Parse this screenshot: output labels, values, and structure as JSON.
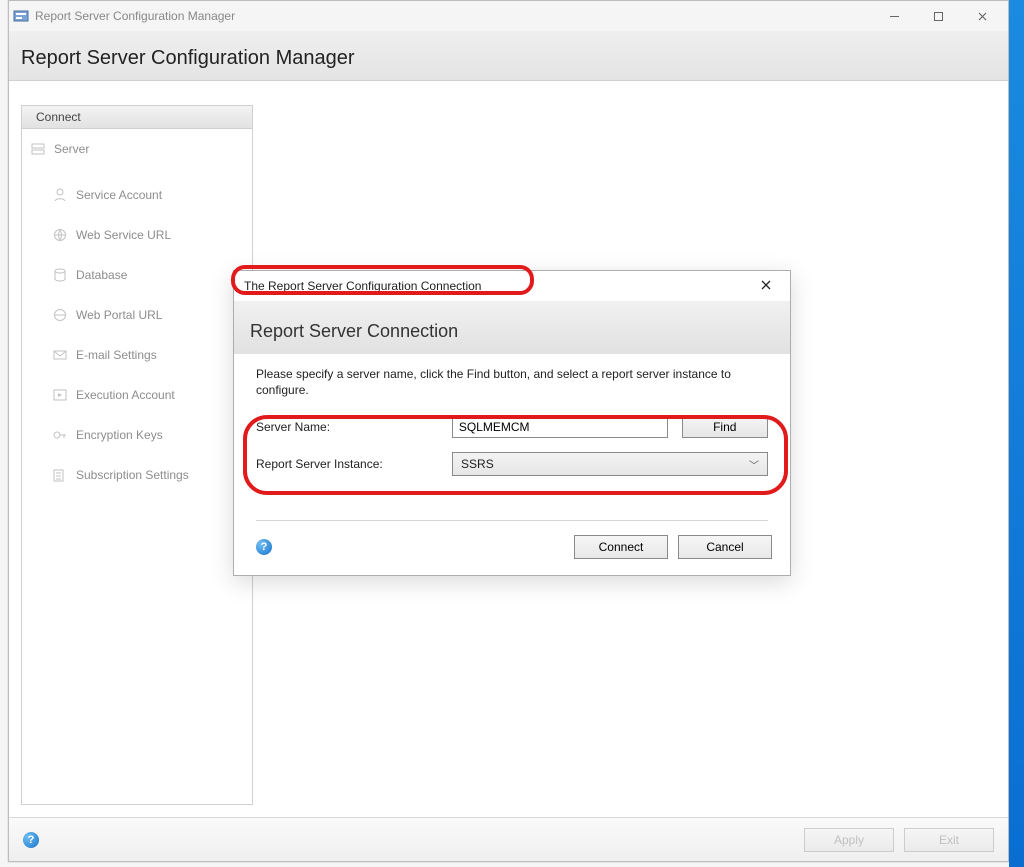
{
  "app": {
    "window_title": "Report Server Configuration Manager",
    "header_title": "Report Server Configuration Manager"
  },
  "sidebar": {
    "connect_label": "Connect",
    "server_label": "Server",
    "items": [
      {
        "label": "Service Account",
        "icon": "account-icon"
      },
      {
        "label": "Web Service URL",
        "icon": "web-icon"
      },
      {
        "label": "Database",
        "icon": "database-icon"
      },
      {
        "label": "Web Portal URL",
        "icon": "globe-icon"
      },
      {
        "label": "E-mail Settings",
        "icon": "mail-icon"
      },
      {
        "label": "Execution Account",
        "icon": "execution-icon"
      },
      {
        "label": "Encryption Keys",
        "icon": "key-icon"
      },
      {
        "label": "Subscription Settings",
        "icon": "subscription-icon"
      }
    ]
  },
  "dialog": {
    "title": "The Report Server Configuration Connection",
    "heading": "Report Server Connection",
    "instruction": "Please specify a server name, click the Find button, and select a report server instance to configure.",
    "server_name_label": "Server Name:",
    "server_name_value": "SQLMEMCM",
    "find_label": "Find",
    "instance_label": "Report Server Instance:",
    "instance_value": "SSRS",
    "connect_btn": "Connect",
    "cancel_btn": "Cancel"
  },
  "footer": {
    "apply_label": "Apply",
    "exit_label": "Exit"
  }
}
